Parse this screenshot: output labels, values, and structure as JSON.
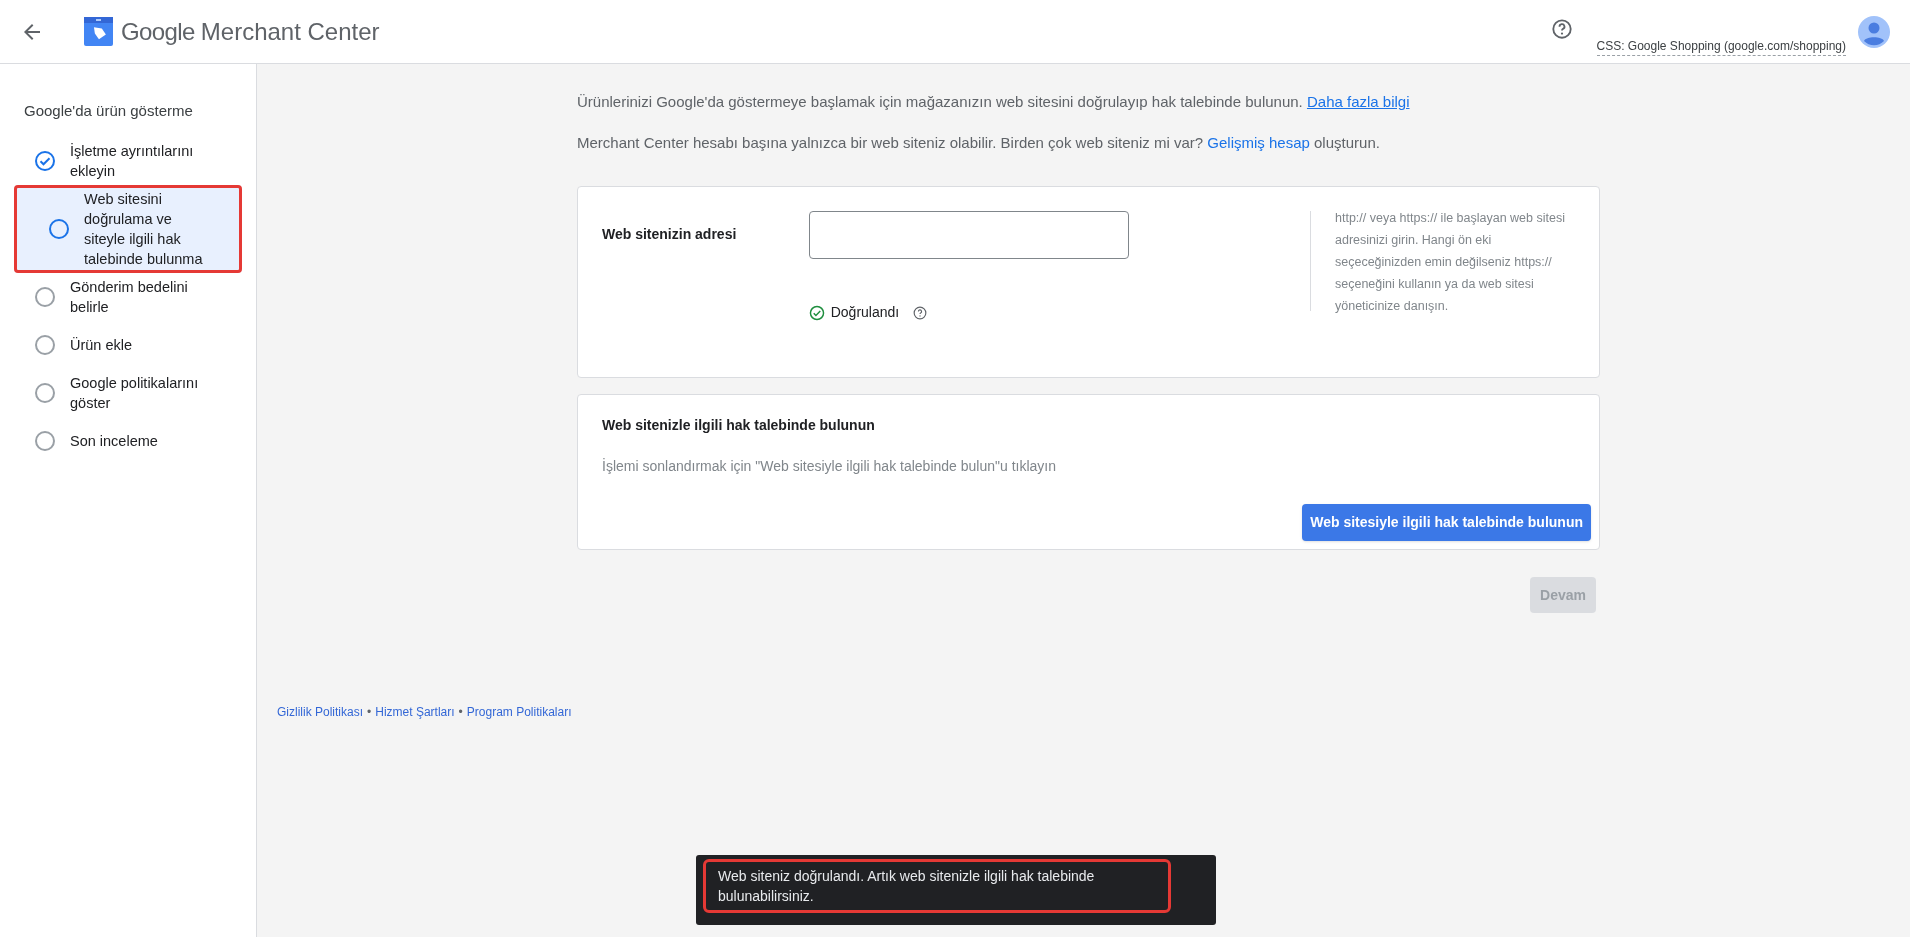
{
  "header": {
    "title_brand": "Google",
    "title_product": "Merchant Center",
    "account": "CSS: Google Shopping (google.com/shopping)"
  },
  "sidebar": {
    "heading": "Google'da ürün gösterme",
    "steps": [
      {
        "label": "İşletme ayrıntılarını ekleyin",
        "done": true,
        "selected": false,
        "annotated": false
      },
      {
        "label": "Web sitesini doğrulama ve siteyle ilgili hak talebinde bulunma",
        "done": false,
        "selected": true,
        "annotated": true
      },
      {
        "label": "Gönderim bedelini belirle",
        "done": false,
        "selected": false,
        "annotated": false
      },
      {
        "label": "Ürün ekle",
        "done": false,
        "selected": false,
        "annotated": false
      },
      {
        "label": "Google politikalarını göster",
        "done": false,
        "selected": false,
        "annotated": false
      },
      {
        "label": "Son inceleme",
        "done": false,
        "selected": false,
        "annotated": false
      }
    ]
  },
  "intro": [
    {
      "before": "Ürünlerinizi Google'da göstermeye başlamak için mağazanızın web sitesini doğrulayıp hak talebinde bulunun. ",
      "link": "Daha fazla bilgi",
      "underlined": true
    },
    {
      "before": "Merchant Center hesabı başına yalnızca bir web siteniz olabilir. Birden çok web siteniz mi var? ",
      "link": "Gelişmiş hesap",
      "underlined": false,
      "after": " oluşturun."
    }
  ],
  "website_card": {
    "label": "Web sitenizin adresi",
    "status": "Doğrulandı",
    "verified": true,
    "help": "http:// veya https:// ile başlayan web sitesi adresinizi girin. Hangi ön eki seçeceğinizden emin değilseniz https:// seçeneğini kullanın ya da web sitesi yöneticinize danışın."
  },
  "claim_card": {
    "title": "Web sitenizle ilgili hak talebinde bulunun",
    "description": "İşlemi sonlandırmak için \"Web sitesiyle ilgili hak talebinde bulun\"u tıklayın",
    "button": "Web sitesiyle ilgili hak talebinde bulunun"
  },
  "continue_button": {
    "label": "Devam",
    "disabled": true
  },
  "footer": [
    {
      "kind": "link",
      "text": "Gizlilik Politikası"
    },
    {
      "kind": "separator",
      "text": "•"
    },
    {
      "kind": "link",
      "text": "Hizmet Şartları"
    },
    {
      "kind": "separator",
      "text": "•"
    },
    {
      "kind": "link",
      "text": "Program Politikaları"
    }
  ],
  "toast": {
    "message": "Web siteniz doğrulandı. Artık web sitenizle ilgili hak talebinde bulunabilirsiniz.",
    "annotated": true
  }
}
